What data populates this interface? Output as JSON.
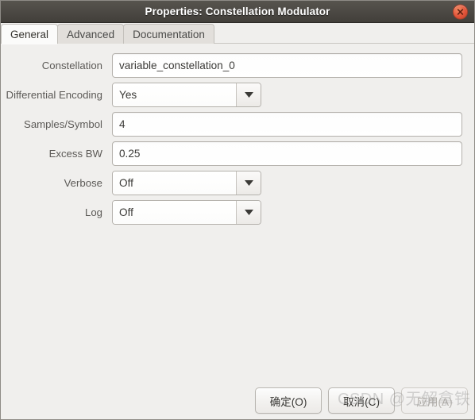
{
  "window": {
    "title": "Properties: Constellation Modulator",
    "close_icon": "close-icon",
    "titlebar_color": "#4b4843",
    "close_button_color": "#e2543a",
    "background_color": "#f0efed"
  },
  "tabs": [
    {
      "label": "General",
      "active": true
    },
    {
      "label": "Advanced",
      "active": false
    },
    {
      "label": "Documentation",
      "active": false
    }
  ],
  "form": {
    "fields": [
      {
        "label": "Constellation",
        "value": "variable_constellation_0",
        "type": "text"
      },
      {
        "label": "Differential Encoding",
        "value": "Yes",
        "type": "combo"
      },
      {
        "label": "Samples/Symbol",
        "value": "4",
        "type": "text"
      },
      {
        "label": "Excess BW",
        "value": "0.25",
        "type": "text"
      },
      {
        "label": "Verbose",
        "value": "Off",
        "type": "combo"
      },
      {
        "label": "Log",
        "value": "Off",
        "type": "combo"
      }
    ]
  },
  "buttons": {
    "ok": "确定(O)",
    "cancel": "取消(C)",
    "apply": "应用(A)"
  },
  "watermark": {
    "text": "CSDN @无解拿铁"
  },
  "icons": {
    "dropdown_arrow": "chevron-down-icon"
  }
}
